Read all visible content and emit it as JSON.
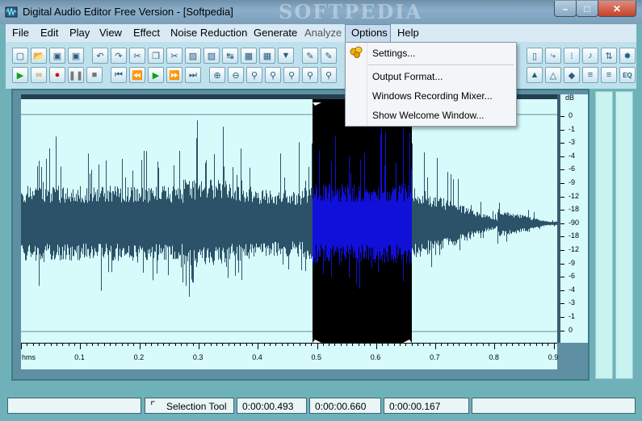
{
  "window": {
    "title": "Digital Audio Editor Free Version - [Softpedia]",
    "watermark": "SOFTPEDIA"
  },
  "menu": [
    "File",
    "Edit",
    "Play",
    "View",
    "Effect",
    "Noise Reduction",
    "Generate",
    "Analyze",
    "Options",
    "Help"
  ],
  "options_menu": {
    "items": [
      "Settings...",
      "Output Format...",
      "Windows Recording Mixer...",
      "Show Welcome Window..."
    ],
    "icon": "settings-icon"
  },
  "db_scale": {
    "unit": "dB",
    "ticks": [
      "0",
      "-1",
      "-3",
      "-4",
      "-6",
      "-9",
      "-12",
      "-18",
      "-90",
      "-18",
      "-12",
      "-9",
      "-6",
      "-4",
      "-3",
      "-1",
      "0"
    ]
  },
  "time_ruler": {
    "unit": "hms",
    "ticks": [
      "0.1",
      "0.2",
      "0.3",
      "0.4",
      "0.5",
      "0.6",
      "0.7",
      "0.8",
      "0.9"
    ]
  },
  "status": {
    "tool": "Selection Tool",
    "start": "0:00:00.493",
    "end": "0:00:00.660",
    "length": "0:00:00.167"
  },
  "colors": {
    "wave": "#2b5268",
    "selection_bg": "#000000",
    "selection_wave": "#1010d8",
    "canvas": "#d7fbfb"
  }
}
